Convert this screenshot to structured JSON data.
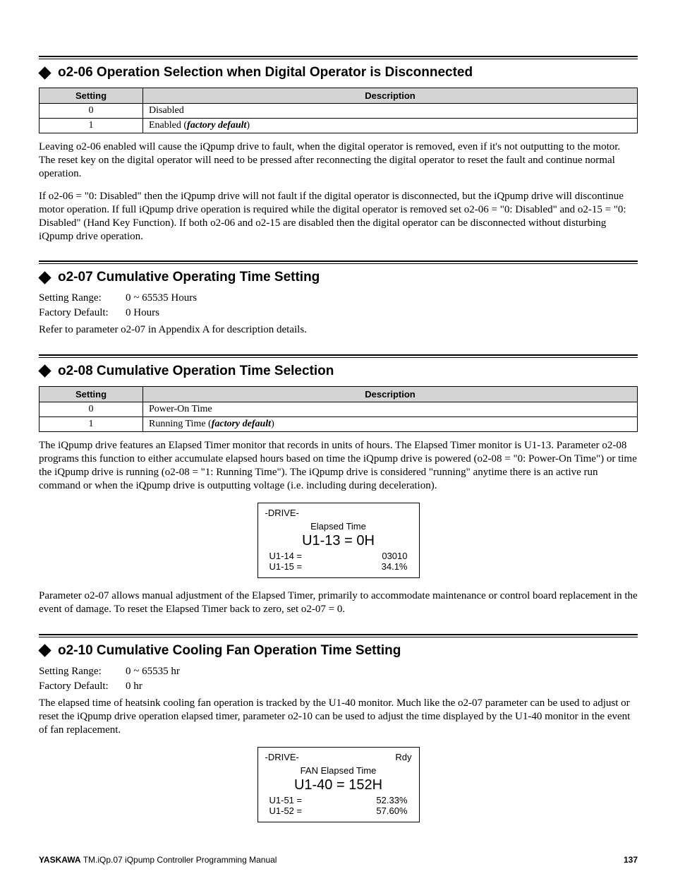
{
  "sec1": {
    "title": "o2-06 Operation Selection when Digital Operator is Disconnected",
    "table": {
      "h1": "Setting",
      "h2": "Description",
      "r0_s": "0",
      "r0_d": "Disabled",
      "r1_s": "1",
      "r1_d_pre": "Enabled (",
      "r1_d_fd": "factory default",
      "r1_d_post": ")"
    },
    "p1": "Leaving o2-06 enabled will cause the iQpump drive to fault, when the digital operator is removed, even if it's not outputting to the motor. The reset key on the digital operator will need to be pressed after reconnecting the digital operator to reset the fault and continue normal operation.",
    "p2": "If o2-06 = \"0: Disabled\" then the iQpump drive will not fault if the digital operator is disconnected, but the iQpump drive will discontinue motor operation. If full iQpump drive operation is required while the digital operator is removed set o2-06 = \"0: Disabled\" and o2-15 = \"0: Disabled\" (Hand Key Function). If both o2-06 and o2-15 are disabled then the digital operator can be disconnected without disturbing iQpump drive operation."
  },
  "sec2": {
    "title": "o2-07 Cumulative Operating Time Setting",
    "sr_label": "Setting Range:",
    "sr_val": "0 ~ 65535 Hours",
    "fd_label": "Factory Default:",
    "fd_val": "0 Hours",
    "p1": "Refer to parameter o2-07 in Appendix A for description details."
  },
  "sec3": {
    "title": "o2-08 Cumulative Operation Time Selection",
    "table": {
      "h1": "Setting",
      "h2": "Description",
      "r0_s": "0",
      "r0_d": "Power-On Time",
      "r1_s": "1",
      "r1_d_pre": "Running Time (",
      "r1_d_fd": "factory default",
      "r1_d_post": ")"
    },
    "p1": "The iQpump drive features an Elapsed Timer monitor that records in units of hours. The Elapsed Timer monitor is U1-13. Parameter o2-08 programs this function to either accumulate elapsed hours based on time the iQpump drive is powered (o2-08 = \"0: Power-On Time\") or time the iQpump drive is running (o2-08 = \"1: Running Time\"). The iQpump drive is considered \"running\" anytime there is an active run command or when the iQpump drive is outputting voltage (i.e. including during deceleration).",
    "disp": {
      "top_l": "-DRIVE-",
      "top_r": "",
      "title": "Elapsed Time",
      "big": "U1-13 = 0H",
      "r1_l": "U1-14 =",
      "r1_r": "03010",
      "r2_l": "U1-15 =",
      "r2_r": "34.1%"
    },
    "p2": "Parameter o2-07 allows manual adjustment of the Elapsed Timer, primarily to accommodate maintenance or control board replacement in the event of damage. To reset the Elapsed Timer back to zero, set o2-07 = 0."
  },
  "sec4": {
    "title": "o2-10 Cumulative Cooling Fan Operation Time Setting",
    "sr_label": "Setting Range:",
    "sr_val": "0 ~ 65535 hr",
    "fd_label": "Factory Default:",
    "fd_val": "0 hr",
    "p1": "The elapsed time of heatsink cooling fan operation is tracked by the U1-40 monitor. Much like the o2-07 parameter can be used to adjust or reset the iQpump drive operation elapsed timer, parameter o2-10 can be used to adjust the time displayed by the U1-40 monitor in the event of fan replacement.",
    "disp": {
      "top_l": "-DRIVE-",
      "top_r": "Rdy",
      "title": "FAN Elapsed Time",
      "big": "U1-40 = 152H",
      "r1_l": "U1-51 =",
      "r1_r": "52.33%",
      "r2_l": "U1-52 =",
      "r2_r": "57.60%"
    }
  },
  "footer": {
    "left_bold": "YASKAWA",
    "left_rest": " TM.iQp.07 iQpump Controller Programming Manual",
    "page": "137"
  }
}
